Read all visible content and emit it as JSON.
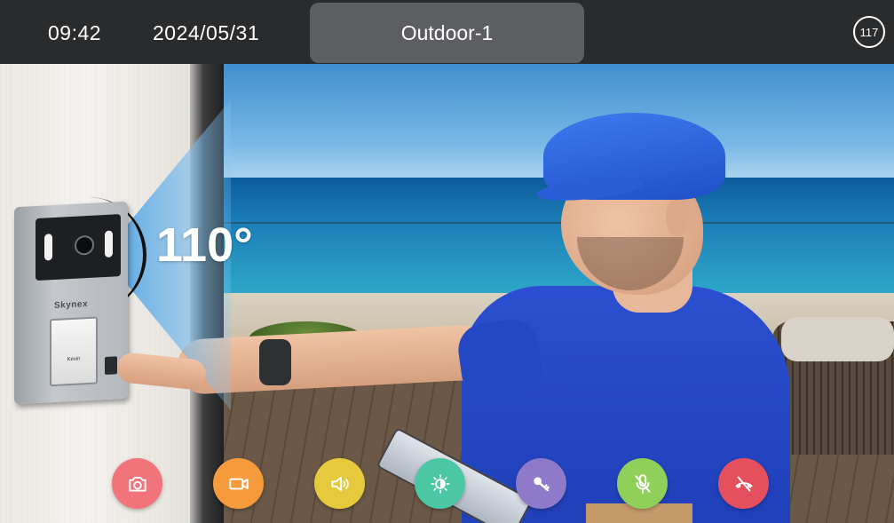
{
  "status_bar": {
    "time": "09:42",
    "date": "2024/05/31",
    "channel_title": "Outdoor-1",
    "counter_badge": "117"
  },
  "scene": {
    "angle_label": "110°",
    "device_brand": "Skynex",
    "card_label": "Kevin"
  },
  "controls": [
    {
      "name": "snapshot-button",
      "icon": "camera-icon",
      "color": "#f0747a"
    },
    {
      "name": "record-button",
      "icon": "video-camera-icon",
      "color": "#f59b3b"
    },
    {
      "name": "volume-button",
      "icon": "speaker-icon",
      "color": "#e7c93d"
    },
    {
      "name": "brightness-button",
      "icon": "brightness-icon",
      "color": "#4bc7a3"
    },
    {
      "name": "unlock-button",
      "icon": "key-icon",
      "color": "#8f79c9"
    },
    {
      "name": "mute-mic-button",
      "icon": "mic-off-icon",
      "color": "#8fcf5a"
    },
    {
      "name": "hang-up-button",
      "icon": "hang-up-icon",
      "color": "#e64f5e"
    }
  ]
}
